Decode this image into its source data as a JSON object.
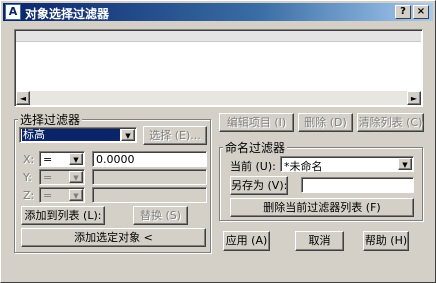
{
  "window": {
    "title": "对象选择过滤器",
    "help_icon": "?",
    "close_icon": "×",
    "app_icon_glyph": "A"
  },
  "list": {
    "scroll_left": "◄",
    "scroll_right": "►"
  },
  "select_group": {
    "title": "选择过滤器",
    "object_type_value": "标高",
    "select_button": "选择 (E)...",
    "x_label": "X:",
    "y_label": "Y:",
    "z_label": "Z:",
    "x_operator": "=",
    "y_operator": "=",
    "z_operator": "=",
    "x_value": "0.0000",
    "y_value": "",
    "z_value": "",
    "add_to_list_button": "添加到列表 (L):",
    "replace_button": "替换 (S)",
    "add_selected_button": "添加选定对象 <"
  },
  "list_buttons": {
    "edit": "编辑项目 (I)",
    "delete": "删除 (D)",
    "clear": "清除列表 (C)"
  },
  "named_group": {
    "title": "命名过滤器",
    "current_label": "当前 (U):",
    "current_value": "*未命名",
    "save_as_button": "另存为 (V):",
    "save_as_value": "",
    "delete_filter_button": "删除当前过滤器列表 (F)"
  },
  "dialog_buttons": {
    "apply": "应用 (A)",
    "cancel": "取消",
    "help": "帮助 (H)"
  },
  "colors": {
    "title_start": "#0a246a",
    "title_end": "#a6caf0",
    "face": "#d4d0c8",
    "disabled_text": "#808080"
  }
}
